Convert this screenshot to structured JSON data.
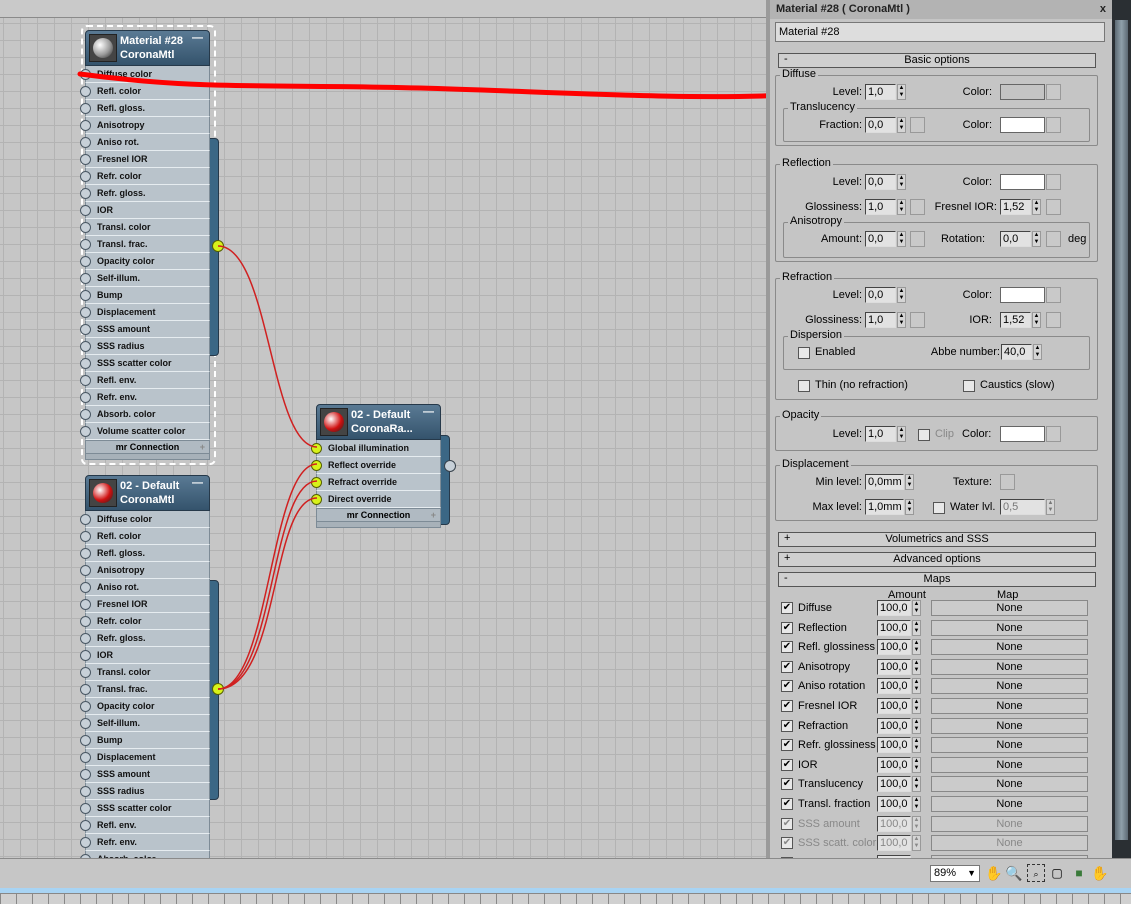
{
  "nodes": [
    {
      "id": "mat28",
      "title": "Material #28",
      "subtitle": "CoronaMtl",
      "ball": "#9a9a9a",
      "sockets": [
        "Diffuse color",
        "Refl. color",
        "Refl. gloss.",
        "Anisotropy",
        "Aniso rot.",
        "Fresnel IOR",
        "Refr. color",
        "Refr. gloss.",
        "IOR",
        "Transl. color",
        "Transl. frac.",
        "Opacity color",
        "Self-illum.",
        "Bump",
        "Displacement",
        "SSS amount",
        "SSS radius",
        "SSS scatter color",
        "Refl. env.",
        "Refr. env.",
        "Absorb. color",
        "Volume scatter color"
      ],
      "footer": "mr Connection",
      "connected": []
    },
    {
      "id": "default02",
      "title": "02 - Default",
      "subtitle": "CoronaMtl",
      "ball": "#d01010",
      "sockets": [
        "Diffuse color",
        "Refl. color",
        "Refl. gloss.",
        "Anisotropy",
        "Aniso rot.",
        "Fresnel IOR",
        "Refr. color",
        "Refr. gloss.",
        "IOR",
        "Transl. color",
        "Transl. frac.",
        "Opacity color",
        "Self-illum.",
        "Bump",
        "Displacement",
        "SSS amount",
        "SSS radius",
        "SSS scatter color",
        "Refl. env.",
        "Refr. env.",
        "Absorb. color"
      ],
      "connected": []
    },
    {
      "id": "raysw",
      "title": "02 - Default",
      "subtitle": "CoronaRa...",
      "ball": "#d01010",
      "sockets": [
        "Global illumination",
        "Reflect override",
        "Refract override",
        "Direct override"
      ],
      "footer": "mr Connection",
      "connected": [
        0,
        1,
        2,
        3
      ]
    }
  ],
  "panel": {
    "title": "Material #28  ( CoronaMtl )",
    "close": "x",
    "name_value": "Material #28",
    "basic": {
      "sign": "-",
      "label": "Basic options"
    },
    "diffuse": {
      "group": "Diffuse",
      "level_label": "Level:",
      "level": "1,0",
      "color_label": "Color:",
      "color": "#c4c4c4",
      "transl_group": "Translucency",
      "fraction_label": "Fraction:",
      "fraction": "0,0",
      "tcolor_label": "Color:",
      "tcolor": "#ffffff"
    },
    "reflection": {
      "group": "Reflection",
      "level_label": "Level:",
      "level": "0,0",
      "color_label": "Color:",
      "color": "#ffffff",
      "gloss_label": "Glossiness:",
      "gloss": "1,0",
      "fresnel_label": "Fresnel IOR:",
      "fresnel": "1,52",
      "aniso_group": "Anisotropy",
      "amount_label": "Amount:",
      "amount": "0,0",
      "rotation_label": "Rotation:",
      "rotation": "0,0",
      "deg": "deg"
    },
    "refraction": {
      "group": "Refraction",
      "level_label": "Level:",
      "level": "0,0",
      "color_label": "Color:",
      "color": "#ffffff",
      "gloss_label": "Glossiness:",
      "gloss": "1,0",
      "ior_label": "IOR:",
      "ior": "1,52",
      "disp_group": "Dispersion",
      "enabled_label": "Enabled",
      "enabled": false,
      "abbe_label": "Abbe number:",
      "abbe": "40,0",
      "thin_label": "Thin (no refraction)",
      "thin": false,
      "caustics_label": "Caustics (slow)",
      "caustics": false
    },
    "opacity": {
      "group": "Opacity",
      "level_label": "Level:",
      "level": "1,0",
      "clip_label": "Clip",
      "clip": false,
      "color_label": "Color:",
      "color": "#ffffff"
    },
    "displacement": {
      "group": "Displacement",
      "min_label": "Min level:",
      "min": "0,0mm",
      "texture_label": "Texture:",
      "max_label": "Max level:",
      "max": "1,0mm",
      "water_label": "Water lvl.",
      "water": "0,5",
      "water_enabled": false
    },
    "volumetrics": {
      "sign": "+",
      "label": "Volumetrics and SSS"
    },
    "advanced": {
      "sign": "+",
      "label": "Advanced options"
    },
    "maps": {
      "sign": "-",
      "label": "Maps",
      "amount_header": "Amount",
      "map_header": "Map",
      "rows": [
        {
          "name": "Diffuse",
          "amount": "100,0",
          "map": "None",
          "checked": true,
          "enabled": true
        },
        {
          "name": "Reflection",
          "amount": "100,0",
          "map": "None",
          "checked": true,
          "enabled": true
        },
        {
          "name": "Refl. glossiness",
          "amount": "100,0",
          "map": "None",
          "checked": true,
          "enabled": true
        },
        {
          "name": "Anisotropy",
          "amount": "100,0",
          "map": "None",
          "checked": true,
          "enabled": true
        },
        {
          "name": "Aniso rotation",
          "amount": "100,0",
          "map": "None",
          "checked": true,
          "enabled": true
        },
        {
          "name": "Fresnel IOR",
          "amount": "100,0",
          "map": "None",
          "checked": true,
          "enabled": true
        },
        {
          "name": "Refraction",
          "amount": "100,0",
          "map": "None",
          "checked": true,
          "enabled": true
        },
        {
          "name": "Refr. glossiness",
          "amount": "100,0",
          "map": "None",
          "checked": true,
          "enabled": true
        },
        {
          "name": "IOR",
          "amount": "100,0",
          "map": "None",
          "checked": true,
          "enabled": true
        },
        {
          "name": "Translucency",
          "amount": "100,0",
          "map": "None",
          "checked": true,
          "enabled": true
        },
        {
          "name": "Transl. fraction",
          "amount": "100,0",
          "map": "None",
          "checked": true,
          "enabled": true
        },
        {
          "name": "SSS amount",
          "amount": "100,0",
          "map": "None",
          "checked": true,
          "enabled": false
        },
        {
          "name": "SSS scatt. color",
          "amount": "100,0",
          "map": "None",
          "checked": true,
          "enabled": false
        }
      ]
    }
  },
  "statusbar": {
    "zoom": "89%",
    "icons": [
      "pan-hand-icon",
      "zoom-icon",
      "zoom-region-icon",
      "zoom-extents-icon",
      "zoom-extents-selected-icon",
      "pan-to-selected-icon"
    ]
  },
  "colors": {
    "wire": "#d02020",
    "annotation": "#ff0000",
    "socket_connected": "#d8f21a",
    "node_header": "#34536c"
  }
}
